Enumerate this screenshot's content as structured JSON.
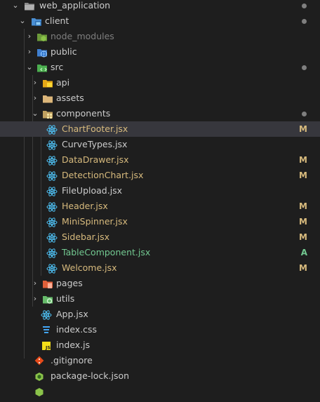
{
  "colors": {
    "modified": "#d7ba7d",
    "added": "#73c991",
    "react": "#4fc3f7",
    "folder": "#dcb67a"
  },
  "tree": {
    "web_application": {
      "label": "web_application",
      "icon": "folder-open-icon"
    },
    "client": {
      "label": "client",
      "icon": "client-folder-icon"
    },
    "node_modules": {
      "label": "node_modules",
      "icon": "node-folder-icon"
    },
    "public": {
      "label": "public",
      "icon": "public-folder-icon"
    },
    "src": {
      "label": "src",
      "icon": "src-folder-icon"
    },
    "api": {
      "label": "api",
      "icon": "api-folder-icon"
    },
    "assets": {
      "label": "assets",
      "icon": "folder-icon"
    },
    "components": {
      "label": "components",
      "icon": "components-folder-icon"
    },
    "pages": {
      "label": "pages",
      "icon": "pages-folder-icon"
    },
    "utils": {
      "label": "utils",
      "icon": "utils-folder-icon"
    }
  },
  "files": {
    "ChartFooter": {
      "label": "ChartFooter.jsx",
      "status": "M"
    },
    "CurveTypes": {
      "label": "CurveTypes.jsx",
      "status": ""
    },
    "DataDrawer": {
      "label": "DataDrawer.jsx",
      "status": "M"
    },
    "DetectionChart": {
      "label": "DetectionChart.jsx",
      "status": "M"
    },
    "FileUpload": {
      "label": "FileUpload.jsx",
      "status": ""
    },
    "Header": {
      "label": "Header.jsx",
      "status": "M"
    },
    "MiniSpinner": {
      "label": "MiniSpinner.jsx",
      "status": "M"
    },
    "Sidebar": {
      "label": "Sidebar.jsx",
      "status": "M"
    },
    "TableComponent": {
      "label": "TableComponent.jsx",
      "status": "A"
    },
    "Welcome": {
      "label": "Welcome.jsx",
      "status": "M"
    },
    "App": {
      "label": "App.jsx",
      "status": ""
    },
    "index_css": {
      "label": "index.css",
      "status": ""
    },
    "index_js": {
      "label": "index.js",
      "status": ""
    },
    "gitignore": {
      "label": ".gitignore",
      "status": ""
    },
    "package_lock": {
      "label": "package-lock.json",
      "status": ""
    }
  }
}
